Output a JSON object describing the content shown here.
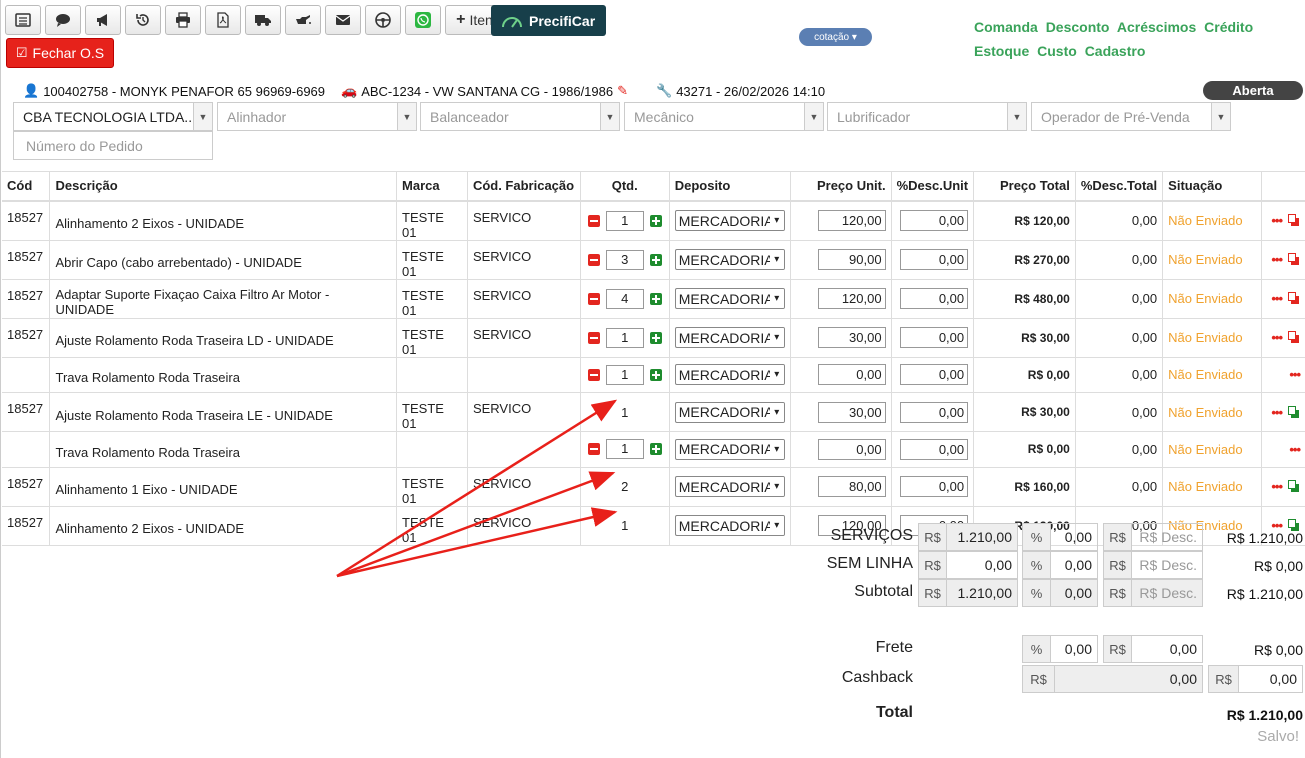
{
  "toolbar": {
    "itens_label": "Itens",
    "precificar_label": "PrecifiCar",
    "fechar_label": "Fechar O.S",
    "cotacao_label": "cotação"
  },
  "top_links": [
    "Comanda",
    "Desconto",
    "Acréscimos",
    "Crédito",
    "Estoque",
    "Custo",
    "Cadastro"
  ],
  "info": {
    "cliente": "100402758 - MONYK PENAFOR 65 96969-6969",
    "veiculo": "ABC-1234 - VW SANTANA CG - 1986/1986",
    "os": "43271 - 26/02/2026 14:10",
    "status": "Aberta"
  },
  "selects": {
    "empresa": "CBA TECNOLOGIA LTDA...",
    "alinhador": "Alinhador",
    "balanceador": "Balanceador",
    "mecanico": "Mecânico",
    "lubrificador": "Lubrificador",
    "operador": "Operador de Pré-Venda",
    "pedido_placeholder": "Número do Pedido"
  },
  "table": {
    "headers": [
      "Cód",
      "Descrição",
      "Marca",
      "Cód. Fabricação",
      "Qtd.",
      "Deposito",
      "Preço Unit.",
      "%Desc.Unit",
      "Preço Total",
      "%Desc.Total",
      "Situação"
    ],
    "rows": [
      {
        "cod": "18527",
        "desc": "Alinhamento 2 Eixos - UNIDADE",
        "marca": "TESTE 01",
        "fab": "SERVICO",
        "qtd": "1",
        "dep": "MERCADORIA",
        "unit": "120,00",
        "descu": "0,00",
        "total": "R$ 120,00",
        "desct": "0,00",
        "sit": "Não Enviado"
      },
      {
        "cod": "18527",
        "desc": "Abrir Capo (cabo arrebentado) - UNIDADE",
        "marca": "TESTE 01",
        "fab": "SERVICO",
        "qtd": "3",
        "dep": "MERCADORIA",
        "unit": "90,00",
        "descu": "0,00",
        "total": "R$ 270,00",
        "desct": "0,00",
        "sit": "Não Enviado"
      },
      {
        "cod": "18527",
        "desc": "Adaptar Suporte Fixaçao Caixa Filtro Ar Motor - UNIDADE",
        "marca": "TESTE 01",
        "fab": "SERVICO",
        "qtd": "4",
        "dep": "MERCADORIA",
        "unit": "120,00",
        "descu": "0,00",
        "total": "R$ 480,00",
        "desct": "0,00",
        "sit": "Não Enviado"
      },
      {
        "cod": "18527",
        "desc": "Ajuste Rolamento Roda Traseira LD - UNIDADE",
        "marca": "TESTE 01",
        "fab": "SERVICO",
        "qtd": "1",
        "dep": "MERCADORIA",
        "unit": "30,00",
        "descu": "0,00",
        "total": "R$ 30,00",
        "desct": "0,00",
        "sit": "Não Enviado"
      },
      {
        "cod": "",
        "desc": "Trava Rolamento Roda Traseira",
        "marca": "",
        "fab": "",
        "qtd": "1",
        "dep": "MERCADORIA",
        "unit": "0,00",
        "descu": "0,00",
        "total": "R$ 0,00",
        "desct": "0,00",
        "sit": "Não Enviado"
      },
      {
        "cod": "18527",
        "desc": "Ajuste Rolamento Roda Traseira LE - UNIDADE",
        "marca": "TESTE 01",
        "fab": "SERVICO",
        "qtd": "1",
        "dep": "MERCADORIA",
        "unit": "30,00",
        "descu": "0,00",
        "total": "R$ 30,00",
        "desct": "0,00",
        "sit": "Não Enviado"
      },
      {
        "cod": "",
        "desc": "Trava Rolamento Roda Traseira",
        "marca": "",
        "fab": "",
        "qtd": "1",
        "dep": "MERCADORIA",
        "unit": "0,00",
        "descu": "0,00",
        "total": "R$ 0,00",
        "desct": "0,00",
        "sit": "Não Enviado"
      },
      {
        "cod": "18527",
        "desc": "Alinhamento 1 Eixo - UNIDADE",
        "marca": "TESTE 01",
        "fab": "SERVICO",
        "qtd": "2",
        "dep": "MERCADORIA",
        "unit": "80,00",
        "descu": "0,00",
        "total": "R$ 160,00",
        "desct": "0,00",
        "sit": "Não Enviado"
      },
      {
        "cod": "18527",
        "desc": "Alinhamento 2 Eixos - UNIDADE",
        "marca": "TESTE 01",
        "fab": "SERVICO",
        "qtd": "1",
        "dep": "MERCADORIA",
        "unit": "120,00",
        "descu": "0,00",
        "total": "R$ 120,00",
        "desct": "0,00",
        "sit": "Não Enviado"
      }
    ]
  },
  "totals": {
    "servicos": {
      "label": "SERVIÇOS",
      "rs": "1.210,00",
      "pct": "0,00",
      "desc_ph": "R$ Desc.",
      "total": "R$ 1.210,00"
    },
    "sem_linha": {
      "label": "SEM LINHA",
      "rs": "0,00",
      "pct": "0,00",
      "desc_ph": "R$ Desc.",
      "total": "R$ 0,00"
    },
    "subtotal": {
      "label": "Subtotal",
      "rs": "1.210,00",
      "pct": "0,00",
      "desc_ph": "R$ Desc.",
      "total": "R$ 1.210,00"
    },
    "frete": {
      "label": "Frete",
      "pct": "0,00",
      "rs": "0,00",
      "total": "R$ 0,00"
    },
    "cashback": {
      "label": "Cashback",
      "rs": "0,00",
      "rs2": "0,00"
    },
    "total": {
      "label": "Total",
      "value": "R$ 1.210,00"
    },
    "saved": "Salvo!"
  },
  "addons": {
    "rs": "R$",
    "pct": "%"
  }
}
